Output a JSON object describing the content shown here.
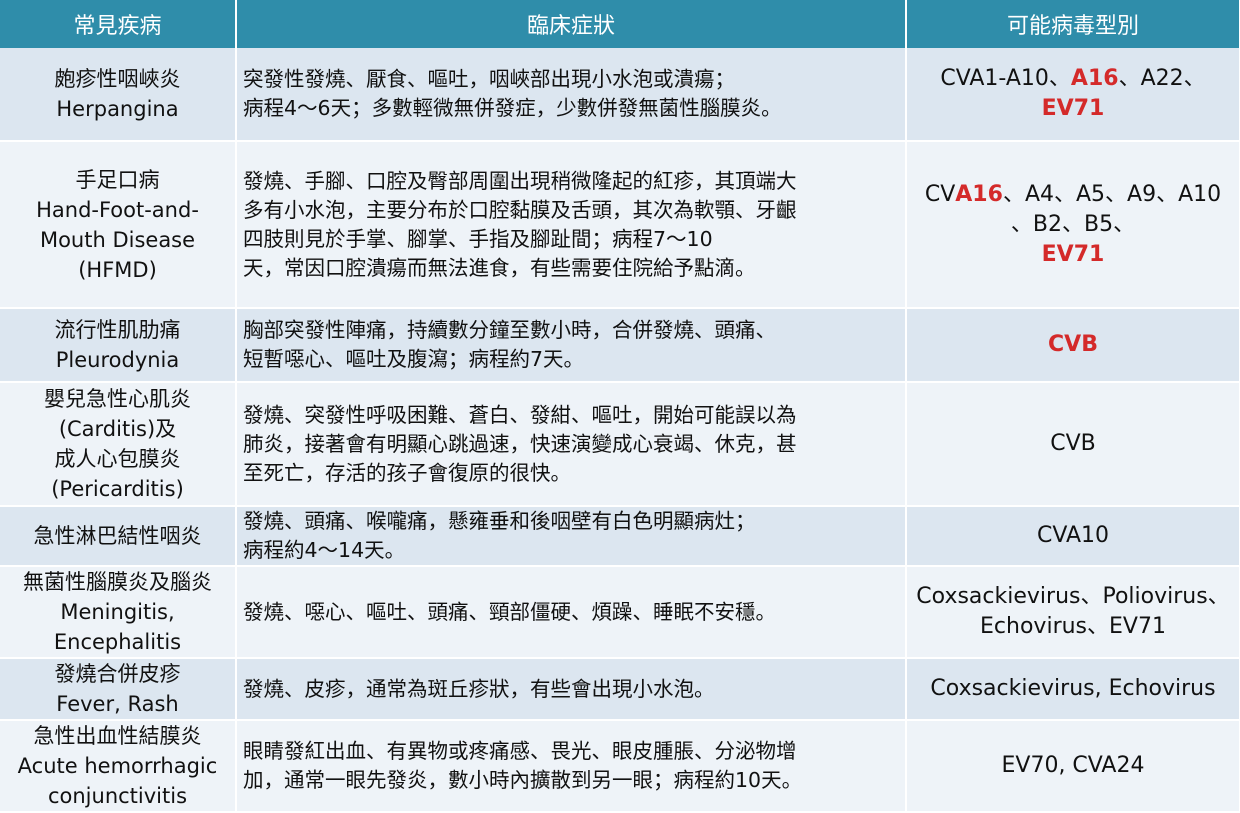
{
  "colors": {
    "header_bg": "#2f8daa",
    "row_odd": "#dce6f0",
    "row_even": "#eef3f8",
    "highlight": "#d42a2a"
  },
  "headers": [
    "常見疾病",
    "臨床症狀",
    "可能病毒型別"
  ],
  "rows": [
    {
      "name": [
        "皰疹性咽峽炎",
        "Herpangina"
      ],
      "symptoms": [
        "突發性發燒、厭食、嘔吐，咽峽部出現小水泡或潰瘍；",
        "病程4～6天；多數輕微無併發症，少數併發無菌性腦膜炎。"
      ],
      "virus": [
        [
          {
            "t": "CVA1-A10、"
          },
          {
            "t": "A16",
            "h": true
          },
          {
            "t": "、A22、"
          }
        ],
        [
          {
            "t": "EV71",
            "h": true
          }
        ]
      ]
    },
    {
      "name": [
        "手足口病",
        "Hand-Foot-and-",
        "Mouth Disease",
        "(HFMD)"
      ],
      "symptoms": [
        "發燒、手腳、口腔及臀部周圍出現稍微隆起的紅疹，其頂端大",
        "多有小水泡，主要分布於口腔黏膜及舌頭，其次為軟顎、牙齦",
        "四肢則見於手掌、腳掌、手指及腳趾間；病程7～10",
        "天，常因口腔潰瘍而無法進食，有些需要住院給予點滴。"
      ],
      "virus": [
        [
          {
            "t": "CV"
          },
          {
            "t": "A16",
            "h": true
          },
          {
            "t": "、A4、A5、A9、A10"
          }
        ],
        [
          {
            "t": "、B2、B5、"
          }
        ],
        [
          {
            "t": "EV71",
            "h": true
          }
        ]
      ]
    },
    {
      "name": [
        "流行性肌肋痛",
        "Pleurodynia"
      ],
      "symptoms": [
        "胸部突發性陣痛，持續數分鐘至數小時，合併發燒、頭痛、",
        "短暫噁心、嘔吐及腹瀉；病程約7天。"
      ],
      "virus": [
        [
          {
            "t": "CVB",
            "h": true
          }
        ]
      ]
    },
    {
      "name": [
        "嬰兒急性心肌炎",
        "(Carditis)及",
        "成人心包膜炎",
        "(Pericarditis)"
      ],
      "symptoms": [
        "發燒、突發性呼吸困難、蒼白、發紺、嘔吐，開始可能誤以為",
        "肺炎，接著會有明顯心跳過速，快速演變成心衰竭、休克，甚",
        "至死亡，存活的孩子會復原的很快。"
      ],
      "virus": [
        [
          {
            "t": "CVB"
          }
        ]
      ]
    },
    {
      "name": [
        "急性淋巴結性咽炎"
      ],
      "symptoms": [
        "發燒、頭痛、喉嚨痛，懸雍垂和後咽壁有白色明顯病灶；",
        "病程約4～14天。"
      ],
      "virus": [
        [
          {
            "t": "CVA10"
          }
        ]
      ]
    },
    {
      "name": [
        "無菌性腦膜炎及腦炎",
        "Meningitis,",
        "Encephalitis"
      ],
      "symptoms": [
        "發燒、噁心、嘔吐、頭痛、頸部僵硬、煩躁、睡眠不安穩。"
      ],
      "virus": [
        [
          {
            "t": "Coxsackievirus、Poliovirus、"
          }
        ],
        [
          {
            "t": "Echovirus、EV71"
          }
        ]
      ]
    },
    {
      "name": [
        "發燒合併皮疹",
        "Fever, Rash"
      ],
      "symptoms": [
        "發燒、皮疹，通常為斑丘疹狀，有些會出現小水泡。"
      ],
      "virus": [
        [
          {
            "t": "Coxsackievirus, Echovirus"
          }
        ]
      ]
    },
    {
      "name": [
        "急性出血性結膜炎",
        "Acute hemorrhagic",
        "conjunctivitis"
      ],
      "symptoms": [
        "眼睛發紅出血、有異物或疼痛感、畏光、眼皮腫脹、分泌物增",
        "加，通常一眼先發炎，數小時內擴散到另一眼；病程約10天。"
      ],
      "virus": [
        [
          {
            "t": "EV70, CVA24"
          }
        ]
      ]
    }
  ]
}
